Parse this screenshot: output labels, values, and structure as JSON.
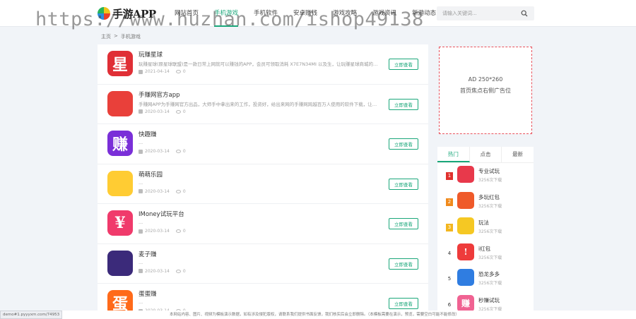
{
  "header": {
    "logo_text": "手游APP",
    "nav": [
      "网站首页",
      "手机游戏",
      "手机软件",
      "安卓赚钱",
      "游戏攻略",
      "游戏资讯",
      "新游动态"
    ],
    "active_nav": 1,
    "search_placeholder": "请输入关键词..."
  },
  "watermark": "https://www.huzhan.com/ishop49138",
  "breadcrumb": {
    "home": "主页",
    "separator": ">",
    "current": "手机游戏"
  },
  "apps": [
    {
      "title": "玩赚星球",
      "desc": "玩赚星球(原星球联盟)是一款日常上网就可以赚钱的APP，会员可领取消耗 X7E7N34MI 以及生，让玩赚星球商城的产品...",
      "date": "2021-04-14",
      "views": "0",
      "button": "立即查看"
    },
    {
      "title": "手赚网官方app",
      "desc": "手赚网APP为手赚网官方出品，大师手中拿出来的工作，投资好，给出来网的手赚网跨越百万人使用的软件下载，让你们手中拿钱...",
      "date": "2020-03-14",
      "views": "0",
      "button": "立即查看"
    },
    {
      "title": "快趣赚",
      "desc": "...",
      "date": "2020-03-14",
      "views": "0",
      "button": "立即查看"
    },
    {
      "title": "萌萌乐园",
      "desc": "...",
      "date": "2020-03-14",
      "views": "0",
      "button": "立即查看"
    },
    {
      "title": "IMoney试玩平台",
      "desc": "...",
      "date": "2020-03-14",
      "views": "0",
      "button": "立即查看"
    },
    {
      "title": "麦子赚",
      "desc": "...",
      "date": "2020-03-14",
      "views": "0",
      "button": "立即查看"
    },
    {
      "title": "蛋蛋赚",
      "desc": "...",
      "date": "2020-03-14",
      "views": "0",
      "button": "立即查看"
    }
  ],
  "ad": {
    "line1": "AD 250*260",
    "line2": "首页焦点右侧广告位"
  },
  "rank": {
    "tabs": [
      "热门",
      "点击",
      "最新"
    ],
    "active_tab": 0,
    "items": [
      {
        "num": "1",
        "name": "专业试玩",
        "downloads": "3256次下载"
      },
      {
        "num": "2",
        "name": "多玩红包",
        "downloads": "3256次下载"
      },
      {
        "num": "3",
        "name": "玩法",
        "downloads": "3256次下载"
      },
      {
        "num": "4",
        "name": "i红包",
        "downloads": "3256次下载"
      },
      {
        "num": "5",
        "name": "恐龙多多",
        "downloads": "3256次下载"
      },
      {
        "num": "6",
        "name": "秒赚试玩",
        "downloads": "3256次下载"
      }
    ]
  },
  "footer": {
    "text": "本网站内容、图片、视频为模板演示数据，如有涉及侵犯版权，请联系我们提供书面反馈，我们核实后会立即删除。（本模板需要在演示，预览，需要空白可能不能修改）",
    "status_url": "demo#1.pyyyxm.com/74953"
  },
  "icons": {
    "apps": [
      {
        "bg": "#e02f36",
        "glyph": "星"
      },
      {
        "bg": "#e9403a",
        "glyph": ""
      },
      {
        "bg": "#7a2fd8",
        "glyph": "赚"
      },
      {
        "bg": "#ffcc33",
        "glyph": ""
      },
      {
        "bg": "#f03a6b",
        "glyph": "¥"
      },
      {
        "bg": "#3b2a7a",
        "glyph": ""
      },
      {
        "bg": "#ff6a1a",
        "glyph": "蛋"
      }
    ],
    "rank": [
      {
        "bg": "#e8394b",
        "glyph": ""
      },
      {
        "bg": "#ef5a2a",
        "glyph": ""
      },
      {
        "bg": "#f5c823",
        "glyph": ""
      },
      {
        "bg": "#ee3b3b",
        "glyph": "!"
      },
      {
        "bg": "#2f7de1",
        "glyph": ""
      },
      {
        "bg": "#f06292",
        "glyph": "赚"
      }
    ]
  },
  "colors": {
    "accent": "#1aa77a",
    "ad_border": "#e8505b"
  }
}
